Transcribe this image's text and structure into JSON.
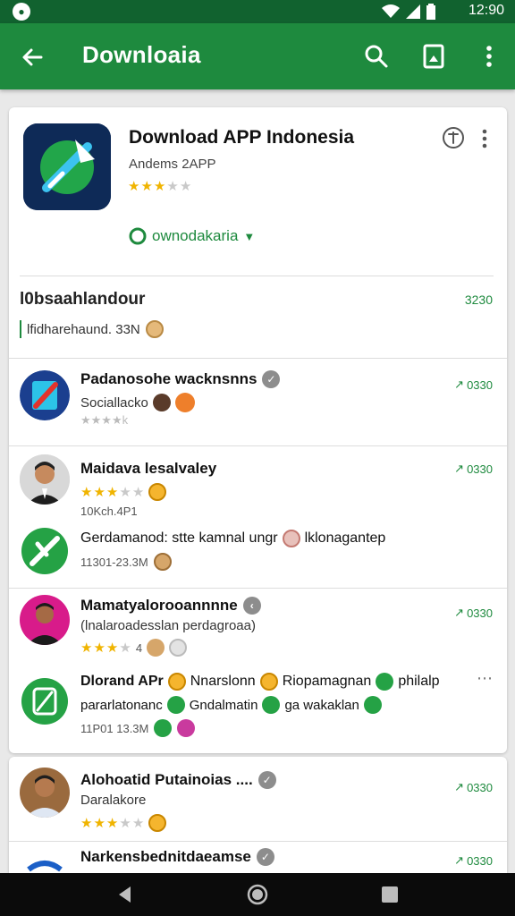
{
  "status_bar": {
    "time": "12:90"
  },
  "app_bar": {
    "title": "Downloaia"
  },
  "hero": {
    "title": "Download APP Indonesia",
    "developer": "Andems 2APP",
    "rating": 3,
    "link_text": "ownodakaria"
  },
  "section": {
    "title": "l0bsaahlandour",
    "count": "3230",
    "subtitle": "lfidharehaund. 33N"
  },
  "items": [
    {
      "name": "Padanosohe wacknsnns",
      "line": "Sociallacko",
      "meta": "★★★★k",
      "download": "0330"
    },
    {
      "name": "Maidava lesalvaley",
      "rating": 3,
      "meta": "10Kch.4P1",
      "download": "0330"
    },
    {
      "name": "Gerdamanod: stte kamnal ungr",
      "name_suffix": "lklonagantep",
      "meta": "11301-23.3M"
    },
    {
      "name": "Mamatyalorooannnne",
      "line": "(lnalaroadesslan perdagroaa)",
      "rating": 3,
      "rating_suffix": "4",
      "download": "0330"
    },
    {
      "name": "Dlorand APr",
      "name_parts": [
        "Nnarslonn",
        "Riopamagnan",
        "philalp"
      ],
      "line_parts": [
        "pararlatonanc",
        "Gndalmatin",
        "ga wakaklan"
      ],
      "meta": "11P01 13.3M"
    },
    {
      "name": "Alohoatid Putainoias ....",
      "line": "Daralakore",
      "rating": 3,
      "download": "0330"
    },
    {
      "name": "Narkensbednitdaeamse",
      "download": "0330"
    }
  ],
  "colors": {
    "primary": "#1e8a3e",
    "primary_dark": "#11622f",
    "star": "#f0b400"
  }
}
